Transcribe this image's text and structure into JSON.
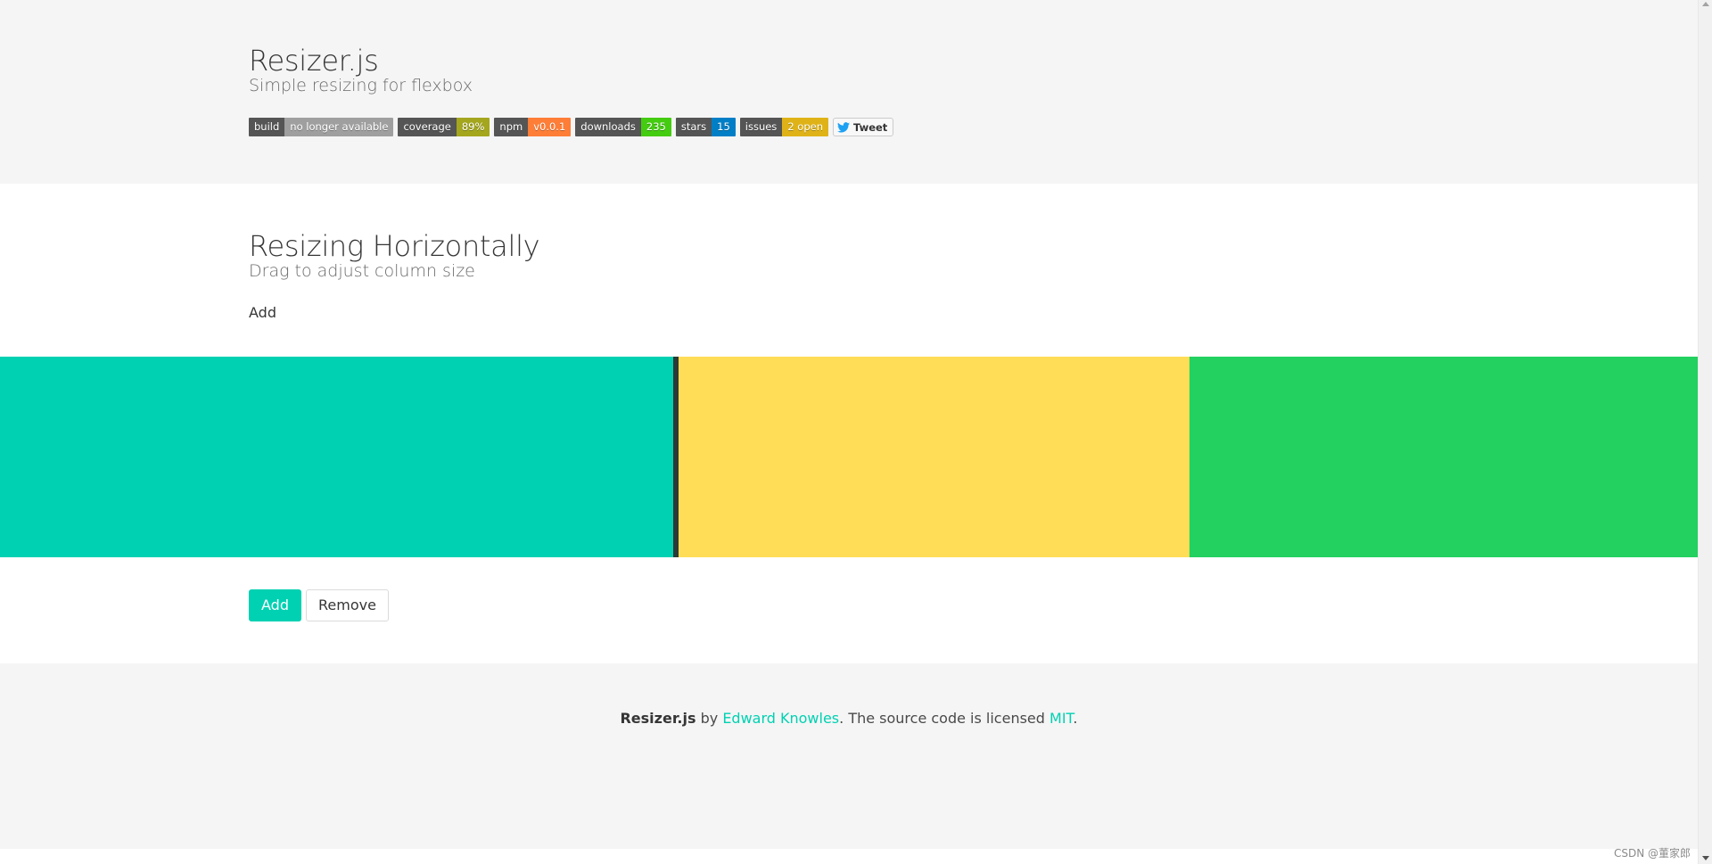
{
  "hero": {
    "title": "Resizer.js",
    "subtitle": "Simple resizing for flexbox",
    "badges": [
      {
        "left": "build",
        "right": "no longer available",
        "color": "#9f9f9f"
      },
      {
        "left": "coverage",
        "right": "89%",
        "color": "#a4a61d"
      },
      {
        "left": "npm",
        "right": "v0.0.1",
        "color": "#fe7d37"
      },
      {
        "left": "downloads",
        "right": "235",
        "color": "#4c1"
      },
      {
        "left": "stars",
        "right": "15",
        "color": "#007ec6"
      },
      {
        "left": "issues",
        "right": "2 open",
        "color": "#dfb317"
      }
    ],
    "tweet_label": "Tweet"
  },
  "section": {
    "title": "Resizing Horizontally",
    "subtitle": "Drag to adjust column size",
    "add_link": "Add",
    "panels": [
      {
        "color": "#00d1b2",
        "fraction": 0.398
      },
      {
        "color": "#ffdd57",
        "fraction": 0.302
      },
      {
        "color": "#23d160",
        "fraction": 0.296
      }
    ],
    "add_button": "Add",
    "remove_button": "Remove"
  },
  "footer": {
    "project": "Resizer.js",
    "by": " by ",
    "author": "Edward Knowles",
    "middle": ". The source code is licensed ",
    "license": "MIT",
    "end": "."
  },
  "watermark": "CSDN @董家郎"
}
